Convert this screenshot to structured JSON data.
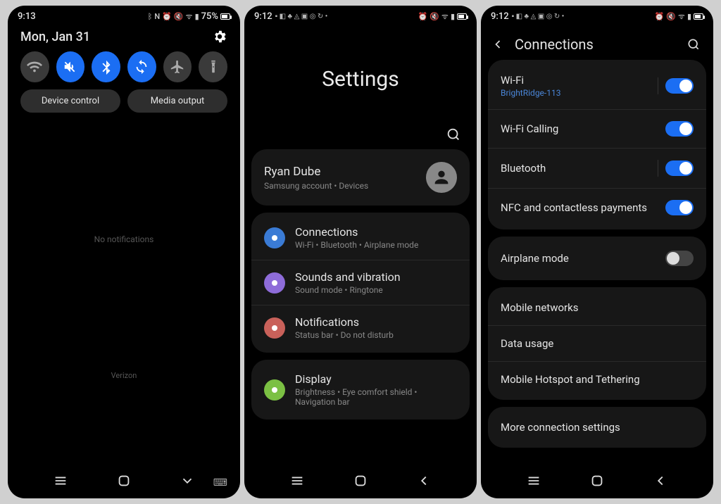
{
  "screen1": {
    "time": "9:13",
    "battery": "75%",
    "date": "Mon, Jan 31",
    "qs_device_control": "Device control",
    "qs_media_output": "Media output",
    "no_notifications": "No notifications",
    "carrier": "Verizon"
  },
  "screen2": {
    "time": "9:12",
    "title": "Settings",
    "profile": {
      "name": "Ryan Dube",
      "sub": "Samsung account  •  Devices"
    },
    "items": [
      {
        "title": "Connections",
        "sub": "Wi-Fi  •  Bluetooth  •  Airplane mode",
        "color": "#3a7bd5"
      },
      {
        "title": "Sounds and vibration",
        "sub": "Sound mode  •  Ringtone",
        "color": "#8e6cd9"
      },
      {
        "title": "Notifications",
        "sub": "Status bar  •  Do not disturb",
        "color": "#c9615a"
      },
      {
        "title": "Display",
        "sub": "Brightness  •  Eye comfort shield  •  Navigation bar",
        "color": "#7bc043"
      }
    ]
  },
  "screen3": {
    "time": "9:12",
    "title": "Connections",
    "group1": [
      {
        "title": "Wi-Fi",
        "sub": "BrightRidge-113",
        "on": true,
        "sep": true
      },
      {
        "title": "Wi-Fi Calling",
        "on": true,
        "sep": false
      },
      {
        "title": "Bluetooth",
        "on": true,
        "sep": true
      },
      {
        "title": "NFC and contactless payments",
        "on": true,
        "sep": false
      }
    ],
    "group2": [
      {
        "title": "Airplane mode",
        "on": false
      }
    ],
    "group3": [
      {
        "title": "Mobile networks"
      },
      {
        "title": "Data usage"
      },
      {
        "title": "Mobile Hotspot and Tethering"
      }
    ],
    "group4": [
      {
        "title": "More connection settings"
      }
    ]
  }
}
